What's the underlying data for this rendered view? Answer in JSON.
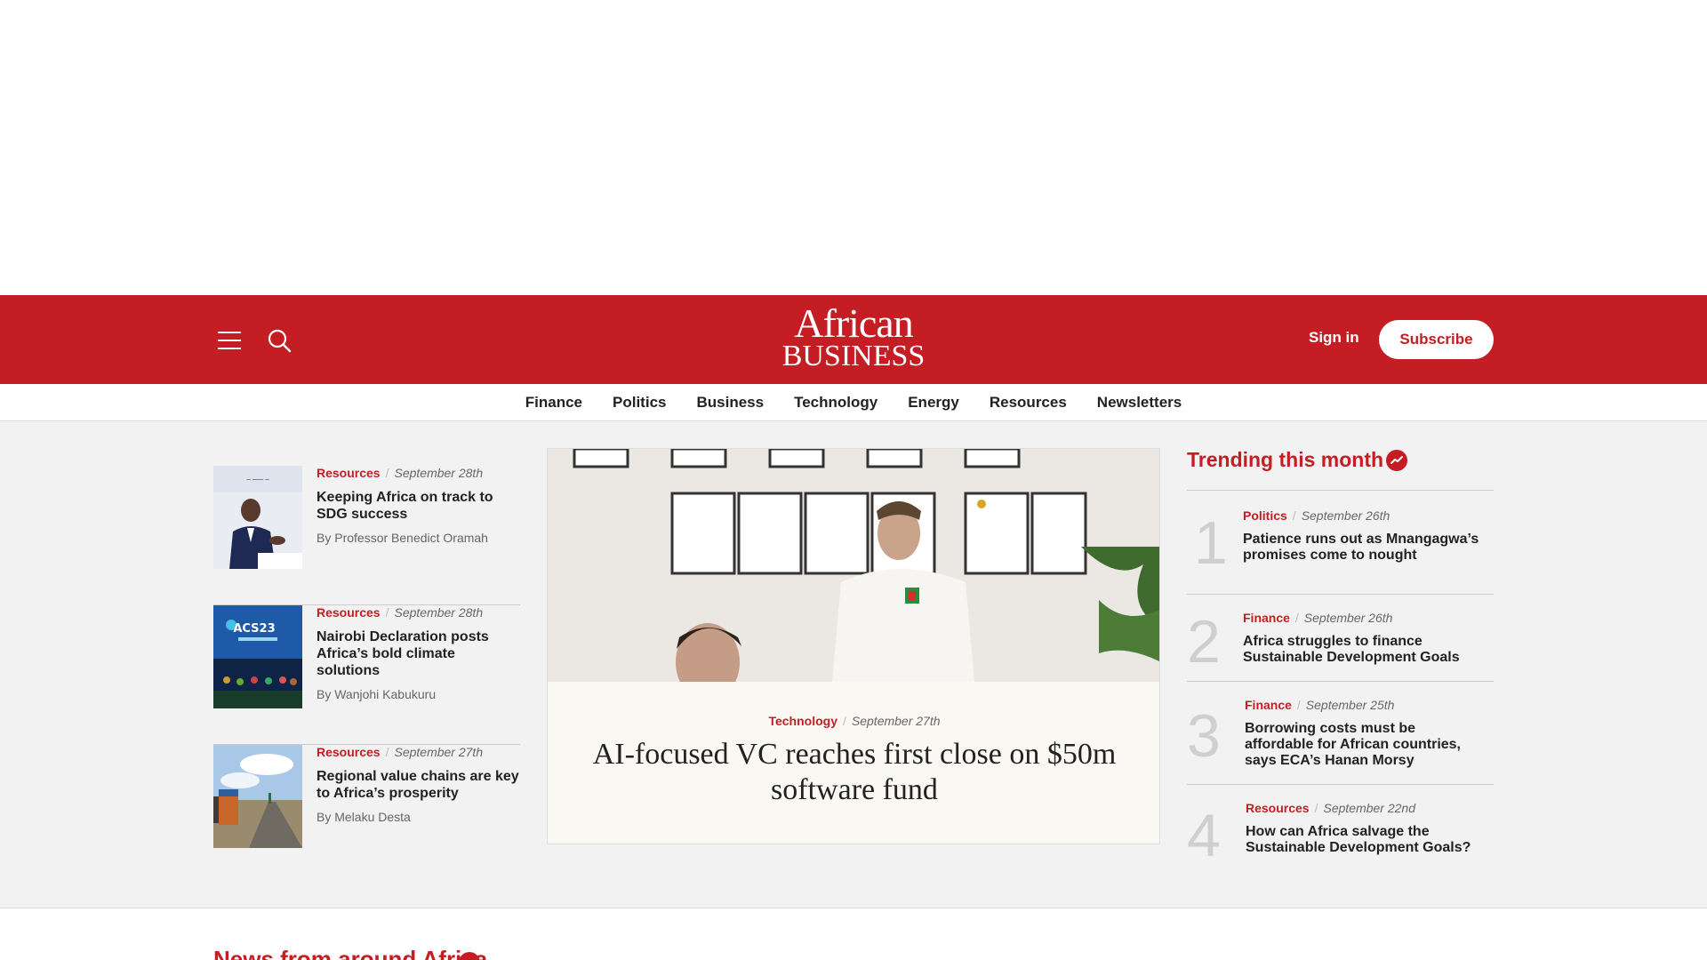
{
  "header": {
    "logo_line1": "African",
    "logo_line2": "BUSINESS",
    "signin_label": "Sign in",
    "subscribe_label": "Subscribe",
    "brand_color": "#c41e24"
  },
  "nav": {
    "items": [
      "Finance",
      "Politics",
      "Business",
      "Technology",
      "Energy",
      "Resources",
      "Newsletters"
    ]
  },
  "left_articles": [
    {
      "category": "Resources",
      "date": "September 28th",
      "headline": "Keeping Africa on track to SDG success",
      "byline": "By Professor Benedict Oramah"
    },
    {
      "category": "Resources",
      "date": "September 28th",
      "headline": "Nairobi Declaration posts Africa’s bold climate solutions",
      "byline": "By Wanjohi Kabukuru"
    },
    {
      "category": "Resources",
      "date": "September 27th",
      "headline": "Regional value chains are key to Africa’s prosperity",
      "byline": "By Melaku Desta"
    }
  ],
  "feature": {
    "category": "Technology",
    "date": "September 27th",
    "title": "AI-focused VC reaches first close on $50m software fund"
  },
  "trending": {
    "title": "Trending this month",
    "icon": "trending-up-icon",
    "items": [
      {
        "rank": "1",
        "category": "Politics",
        "date": "September 26th",
        "headline": "Patience runs out as Mnangagwa’s promises come to nought"
      },
      {
        "rank": "2",
        "category": "Finance",
        "date": "September 26th",
        "headline": "Africa struggles to finance Sustainable Development Goals"
      },
      {
        "rank": "3",
        "category": "Finance",
        "date": "September 25th",
        "headline": "Borrowing costs must be affordable for African countries, says ECA’s Hanan Morsy"
      },
      {
        "rank": "4",
        "category": "Resources",
        "date": "September 22nd",
        "headline": "How can Africa salvage the Sustainable Development Goals?"
      }
    ]
  },
  "next_section": {
    "title": "News from around Africa"
  }
}
